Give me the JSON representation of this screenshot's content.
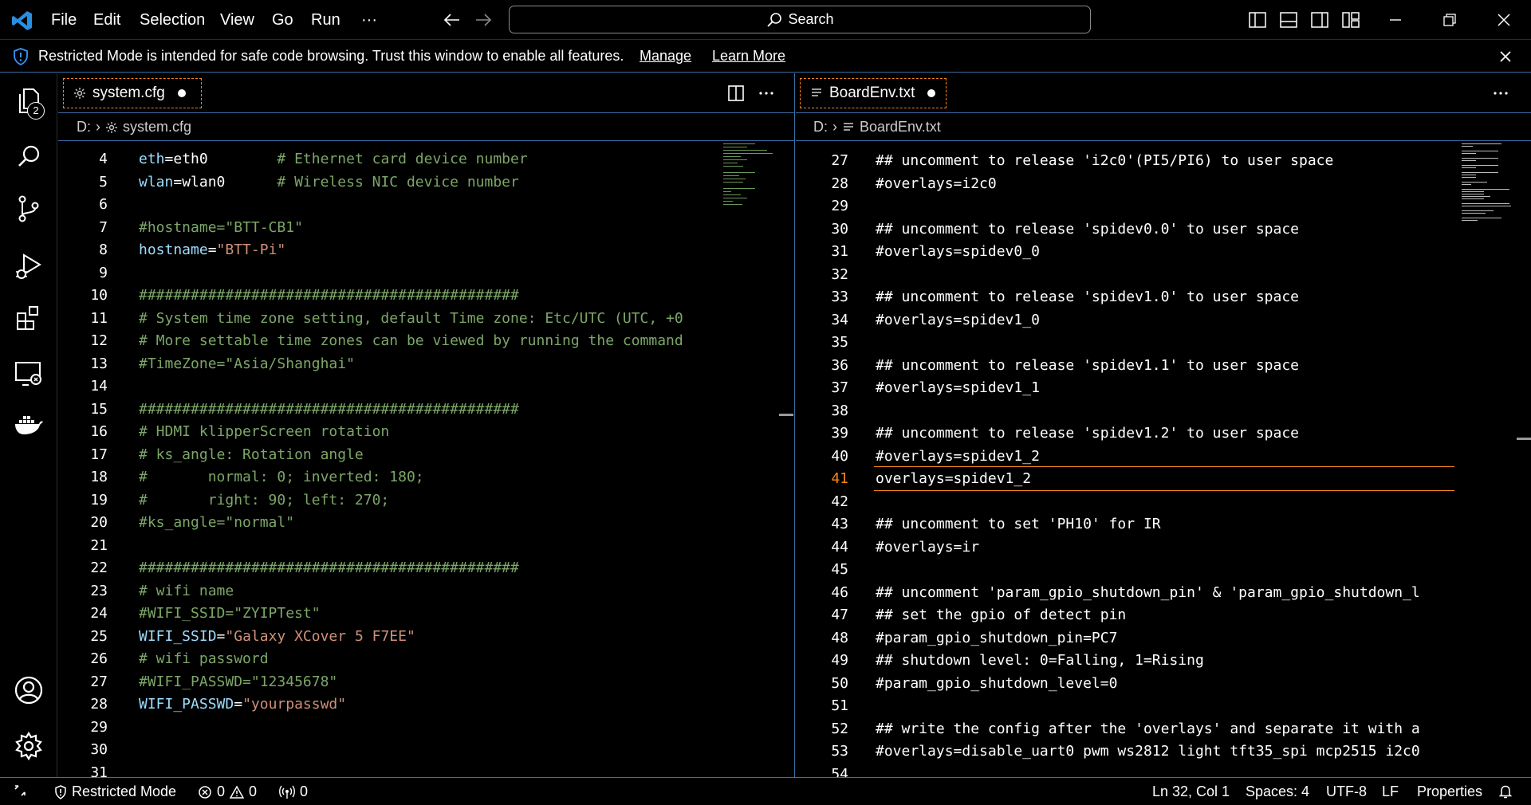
{
  "titlebar": {
    "menu": [
      "File",
      "Edit",
      "Selection",
      "View",
      "Go",
      "Run",
      "···"
    ],
    "search_label": "Search"
  },
  "banner": {
    "message": "Restricted Mode is intended for safe code browsing. Trust this window to enable all features.",
    "manage": "Manage",
    "learn_more": "Learn More"
  },
  "activitybar": {
    "explorer_badge": "2",
    "items": [
      "explorer-icon",
      "search-icon",
      "source-control-icon",
      "run-debug-icon",
      "extensions-icon",
      "remote-explorer-icon",
      "docker-icon",
      "accounts-icon",
      "manage-gear-icon"
    ]
  },
  "left_editor": {
    "tab_name": "system.cfg",
    "breadcrumb": [
      "D:",
      "system.cfg"
    ],
    "lines": [
      {
        "n": "4",
        "parts": [
          [
            "key",
            "eth"
          ],
          [
            "plain",
            "=eth0        "
          ],
          [
            "cmt",
            "# Ethernet card device number"
          ]
        ]
      },
      {
        "n": "5",
        "parts": [
          [
            "key",
            "wlan"
          ],
          [
            "plain",
            "=wlan0      "
          ],
          [
            "cmt",
            "# Wireless NIC device number"
          ]
        ]
      },
      {
        "n": "6",
        "parts": []
      },
      {
        "n": "7",
        "parts": [
          [
            "cmt",
            "#hostname=\"BTT-CB1\""
          ]
        ]
      },
      {
        "n": "8",
        "parts": [
          [
            "key",
            "hostname"
          ],
          [
            "plain",
            "="
          ],
          [
            "str",
            "\"BTT-Pi\""
          ]
        ]
      },
      {
        "n": "9",
        "parts": []
      },
      {
        "n": "10",
        "parts": [
          [
            "cmt",
            "############################################"
          ]
        ]
      },
      {
        "n": "11",
        "parts": [
          [
            "cmt",
            "# System time zone setting, default Time zone: Etc/UTC (UTC, +0"
          ]
        ]
      },
      {
        "n": "12",
        "parts": [
          [
            "cmt",
            "# More settable time zones can be viewed by running the command"
          ]
        ]
      },
      {
        "n": "13",
        "parts": [
          [
            "cmt",
            "#TimeZone=\"Asia/Shanghai\""
          ]
        ]
      },
      {
        "n": "14",
        "parts": []
      },
      {
        "n": "15",
        "parts": [
          [
            "cmt",
            "############################################"
          ]
        ]
      },
      {
        "n": "16",
        "parts": [
          [
            "cmt",
            "# HDMI klipperScreen rotation"
          ]
        ]
      },
      {
        "n": "17",
        "parts": [
          [
            "cmt",
            "# ks_angle: Rotation angle"
          ]
        ]
      },
      {
        "n": "18",
        "parts": [
          [
            "cmt",
            "#       normal: 0; inverted: 180;"
          ]
        ]
      },
      {
        "n": "19",
        "parts": [
          [
            "cmt",
            "#       right: 90; left: 270;"
          ]
        ]
      },
      {
        "n": "20",
        "parts": [
          [
            "cmt",
            "#ks_angle=\"normal\""
          ]
        ]
      },
      {
        "n": "21",
        "parts": []
      },
      {
        "n": "22",
        "parts": [
          [
            "cmt",
            "############################################"
          ]
        ]
      },
      {
        "n": "23",
        "parts": [
          [
            "cmt",
            "# wifi name"
          ]
        ]
      },
      {
        "n": "24",
        "parts": [
          [
            "cmt",
            "#WIFI_SSID=\"ZYIPTest\""
          ]
        ]
      },
      {
        "n": "25",
        "parts": [
          [
            "key",
            "WIFI_SSID"
          ],
          [
            "plain",
            "="
          ],
          [
            "str",
            "\"Galaxy XCover 5 F7EE\""
          ]
        ]
      },
      {
        "n": "26",
        "parts": [
          [
            "cmt",
            "# wifi password"
          ]
        ]
      },
      {
        "n": "27",
        "parts": [
          [
            "cmt",
            "#WIFI_PASSWD=\"12345678\""
          ]
        ]
      },
      {
        "n": "28",
        "parts": [
          [
            "key",
            "WIFI_PASSWD"
          ],
          [
            "plain",
            "="
          ],
          [
            "str",
            "\"yourpasswd\""
          ]
        ]
      },
      {
        "n": "29",
        "parts": []
      },
      {
        "n": "30",
        "parts": []
      },
      {
        "n": "31",
        "parts": []
      }
    ]
  },
  "right_editor": {
    "tab_name": "BoardEnv.txt",
    "breadcrumb": [
      "D:",
      "BoardEnv.txt"
    ],
    "active_line": "41",
    "lines": [
      {
        "n": "27",
        "text": "## uncomment to release 'i2c0'(PI5/PI6) to user space"
      },
      {
        "n": "28",
        "text": "#overlays=i2c0"
      },
      {
        "n": "29",
        "text": ""
      },
      {
        "n": "30",
        "text": "## uncomment to release 'spidev0.0' to user space"
      },
      {
        "n": "31",
        "text": "#overlays=spidev0_0"
      },
      {
        "n": "32",
        "text": ""
      },
      {
        "n": "33",
        "text": "## uncomment to release 'spidev1.0' to user space"
      },
      {
        "n": "34",
        "text": "#overlays=spidev1_0"
      },
      {
        "n": "35",
        "text": ""
      },
      {
        "n": "36",
        "text": "## uncomment to release 'spidev1.1' to user space"
      },
      {
        "n": "37",
        "text": "#overlays=spidev1_1"
      },
      {
        "n": "38",
        "text": ""
      },
      {
        "n": "39",
        "text": "## uncomment to release 'spidev1.2' to user space"
      },
      {
        "n": "40",
        "text": "#overlays=spidev1_2"
      },
      {
        "n": "41",
        "text": "overlays=spidev1_2"
      },
      {
        "n": "42",
        "text": ""
      },
      {
        "n": "43",
        "text": "## uncomment to set 'PH10' for IR"
      },
      {
        "n": "44",
        "text": "#overlays=ir"
      },
      {
        "n": "45",
        "text": ""
      },
      {
        "n": "46",
        "text": "## uncomment 'param_gpio_shutdown_pin' & 'param_gpio_shutdown_l"
      },
      {
        "n": "47",
        "text": "## set the gpio of detect pin"
      },
      {
        "n": "48",
        "text": "#param_gpio_shutdown_pin=PC7"
      },
      {
        "n": "49",
        "text": "## shutdown level: 0=Falling, 1=Rising"
      },
      {
        "n": "50",
        "text": "#param_gpio_shutdown_level=0"
      },
      {
        "n": "51",
        "text": ""
      },
      {
        "n": "52",
        "text": "## write the config after the 'overlays' and separate it with a"
      },
      {
        "n": "53",
        "text": "#overlays=disable_uart0 pwm ws2812 light tft35_spi mcp2515 i2c0"
      },
      {
        "n": "54",
        "text": ""
      }
    ]
  },
  "statusbar": {
    "restricted": "Restricted Mode",
    "errors": "0",
    "warnings": "0",
    "ports": "0",
    "position": "Ln 32, Col 1",
    "spaces": "Spaces: 4",
    "encoding": "UTF-8",
    "eol": "LF",
    "language": "Properties"
  }
}
